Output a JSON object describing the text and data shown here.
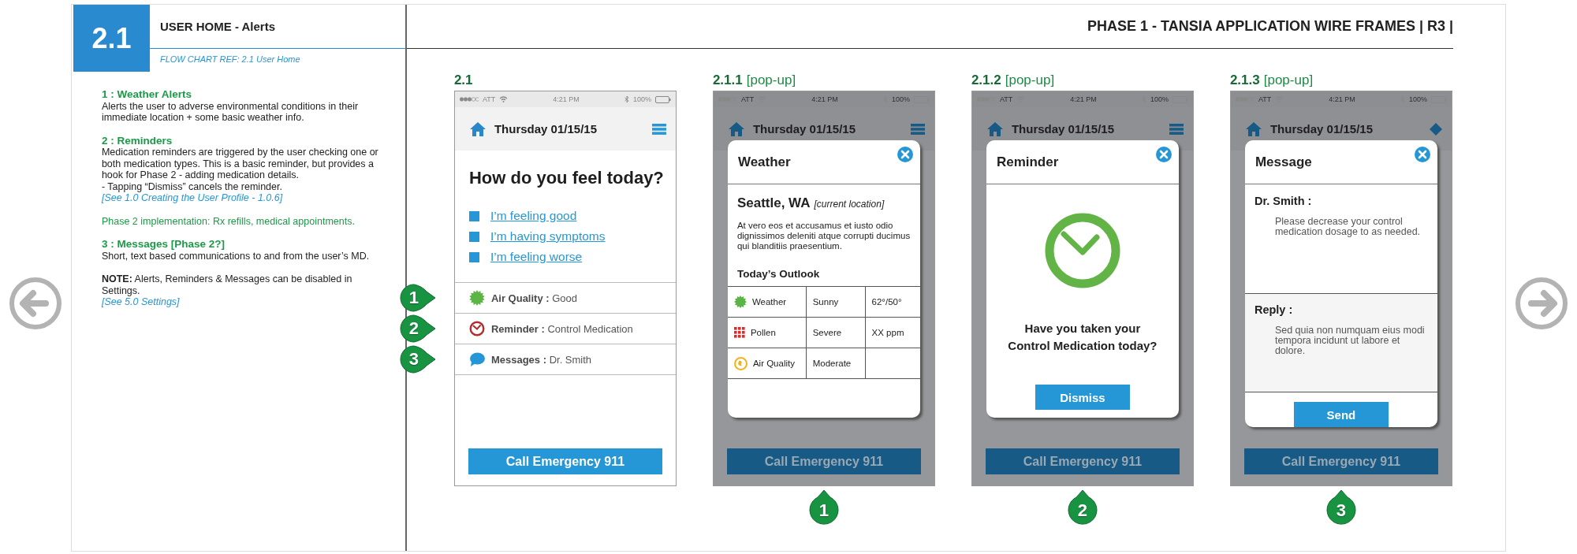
{
  "section": {
    "number": "2.1",
    "title": "USER HOME - Alerts",
    "flow_ref": "FLOW CHART REF:  2.1 User Home"
  },
  "doc_title": "PHASE 1 - TANSIA APPLICATION WIRE FRAMES  | R3 |",
  "notes": [
    {
      "items": [
        {
          "kind": "heading",
          "text": "1 : Weather Alerts"
        },
        {
          "kind": "body",
          "text": "Alerts the user to adverse environmental conditions in their immediate location + some basic weather info."
        }
      ]
    },
    {
      "items": [
        {
          "kind": "heading",
          "text": "2 : Reminders"
        },
        {
          "kind": "body",
          "text": "Medication reminders are triggered by the user checking one or both medication types. This is a basic reminder, but provides a hook for Phase 2  - adding medication details."
        },
        {
          "kind": "body",
          "text": "- Tapping “Dismiss” cancels the reminder."
        },
        {
          "kind": "link",
          "text": "[See 1.0 Creating the User Profile - 1.0.6]"
        }
      ]
    },
    {
      "items": [
        {
          "kind": "highlight",
          "text": "Phase 2 implementation: Rx refills, medical appointments."
        }
      ]
    },
    {
      "items": [
        {
          "kind": "heading",
          "text": "3 : Messages [Phase 2?]"
        },
        {
          "kind": "body",
          "text": "Short, text based communications to and from the user’s MD."
        }
      ]
    },
    {
      "items": [
        {
          "kind": "body",
          "text": "**NOTE:** Alerts, Reminders & Messages can be disabled in Settings."
        },
        {
          "kind": "link",
          "text": "[See 5.0 Settings]"
        }
      ]
    }
  ],
  "screens": [
    {
      "number": "2.1",
      "status": {
        "carrier": "ATT",
        "time": "4:21 PM",
        "battery": "100%"
      },
      "date": "Thursday 01/15/15",
      "header_button": {
        "kind": "menu"
      },
      "dimmed": false,
      "question": "How do you feel today?",
      "options": [
        "I’m feeling good",
        "I’m having symptoms",
        "I’m feeling worse"
      ],
      "alerts": [
        {
          "kind": "air",
          "label": "Air Quality :",
          "value": "Good",
          "badge": "1"
        },
        {
          "kind": "reminder",
          "label": "Reminder :",
          "value": "Control Medication",
          "badge": "2"
        },
        {
          "kind": "message",
          "label": "Messages :",
          "value": "Dr. Smith",
          "badge": "3"
        }
      ],
      "call_button": "Call Emergency 911"
    },
    {
      "number": "2.1.1",
      "tag": "[pop-up]",
      "status": {
        "carrier": "ATT",
        "time": "4:21 PM",
        "battery": "100%"
      },
      "date": "Thursday 01/15/15",
      "header_button": {
        "kind": "menu"
      },
      "dimmed": true,
      "popup": {
        "kind": "weather",
        "title": "Weather",
        "location": "Seattle, WA",
        "location_note": "[current location]",
        "text": "At vero eos et accusamus et iusto odio dignissimos deleniti atque corrupti ducimus qui blanditiis praesentium.",
        "subtitle": "Today’s Outlook",
        "rows": [
          {
            "kind": "sun",
            "cells": [
              "Weather",
              "Sunny",
              "62°/50°"
            ]
          },
          {
            "kind": "pollen",
            "cells": [
              "Pollen",
              "Severe",
              "XX ppm"
            ]
          },
          {
            "kind": "globe",
            "cells": [
              "Air Quality",
              "Moderate"
            ]
          }
        ]
      },
      "call_button": "Call Emergency 911",
      "badge": "1"
    },
    {
      "number": "2.1.2",
      "tag": "[pop-up]",
      "status": {
        "carrier": "ATT",
        "time": "4:21 PM",
        "battery": "100%"
      },
      "date": "Thursday 01/15/15",
      "header_button": {
        "kind": "menu"
      },
      "dimmed": true,
      "popup": {
        "kind": "reminder",
        "title": "Reminder",
        "question": "Have you taken your Control Medication today?",
        "button": "Dismiss"
      },
      "call_button": "Call Emergency 911",
      "badge": "2"
    },
    {
      "number": "2.1.3",
      "tag": "[pop-up]",
      "status": {
        "carrier": "ATT",
        "time": "4:21 PM",
        "battery": "100%"
      },
      "date": "Thursday 01/15/15",
      "header_button": {
        "kind": "diamond"
      },
      "dimmed": true,
      "popup": {
        "kind": "message",
        "title": "Message",
        "sender": "Dr. Smith :",
        "message": "Please decrease your control medication dosage to as needed.",
        "reply_label": "Reply :",
        "reply": "Sed quia non numquam eius modi tempora incidunt ut labore et dolore.",
        "button": "Send"
      },
      "call_button": "Call Emergency 911",
      "badge": "3"
    }
  ]
}
